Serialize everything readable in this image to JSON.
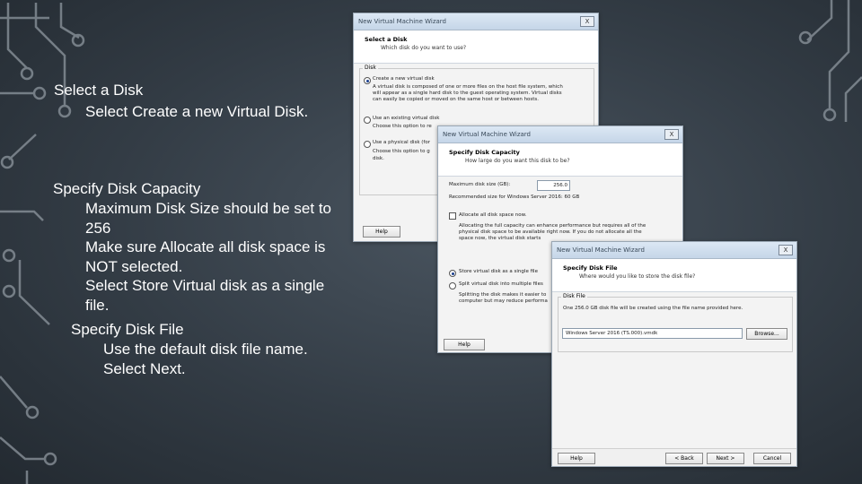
{
  "slide": {
    "line1": "Select a Disk",
    "line2": "Select Create a new Virtual Disk.",
    "line3": "Specify Disk Capacity",
    "line4": "Maximum Disk Size should be set to",
    "line5": "256",
    "line6": "Make sure Allocate all disk space is",
    "line7": "NOT selected.",
    "line8": "Select Store Virtual disk as a single",
    "line9": "file.",
    "line10": "Specify Disk File",
    "line11": "Use the default disk file name.",
    "line12": "Select Next."
  },
  "dialog1": {
    "title": "New Virtual Machine Wizard",
    "close": "X",
    "heading": "Select a Disk",
    "subheading": "Which disk do you want to use?",
    "group_label": "Disk",
    "opt1": "Create a new virtual disk",
    "opt1_desc1": "A virtual disk is composed of one or more files on the host file system, which",
    "opt1_desc2": "will appear as a single hard disk to the guest operating system. Virtual disks",
    "opt1_desc3": "can easily be copied or moved on the same host or between hosts.",
    "opt2": "Use an existing virtual disk",
    "opt2_desc": "Choose this option to re",
    "opt3": "Use a physical disk (for",
    "opt3_desc1": "Choose this option to g",
    "opt3_desc2": "disk.",
    "help": "Help"
  },
  "dialog2": {
    "title": "New Virtual Machine Wizard",
    "close": "X",
    "heading": "Specify Disk Capacity",
    "subheading": "How large do you want this disk to be?",
    "max_label": "Maximum disk size (GB):",
    "max_value": "256.0",
    "recommended": "Recommended size for Windows Server 2016: 60 GB",
    "allocate": "Allocate all disk space now.",
    "alloc_desc1": "Allocating the full capacity can enhance performance but requires all of the",
    "alloc_desc2": "physical disk space to be available right now. If you do not allocate all the",
    "alloc_desc3": "space now, the virtual disk starts",
    "store_single": "Store virtual disk as a single file",
    "split": "Split virtual disk into multiple files",
    "split_desc1": "Splitting the disk makes it easier to",
    "split_desc2": "computer but may reduce performa",
    "help": "Help"
  },
  "dialog3": {
    "title": "New Virtual Machine Wizard",
    "close": "X",
    "heading": "Specify Disk File",
    "subheading": "Where would you like to store the disk file?",
    "group_label": "Disk File",
    "desc": "One 256.0 GB disk file will be created using the file name provided here.",
    "file_value": "Windows Server 2016 (TS.000).vmdk",
    "browse": "Browse...",
    "help": "Help",
    "back": "< Back",
    "next": "Next >",
    "cancel": "Cancel"
  }
}
